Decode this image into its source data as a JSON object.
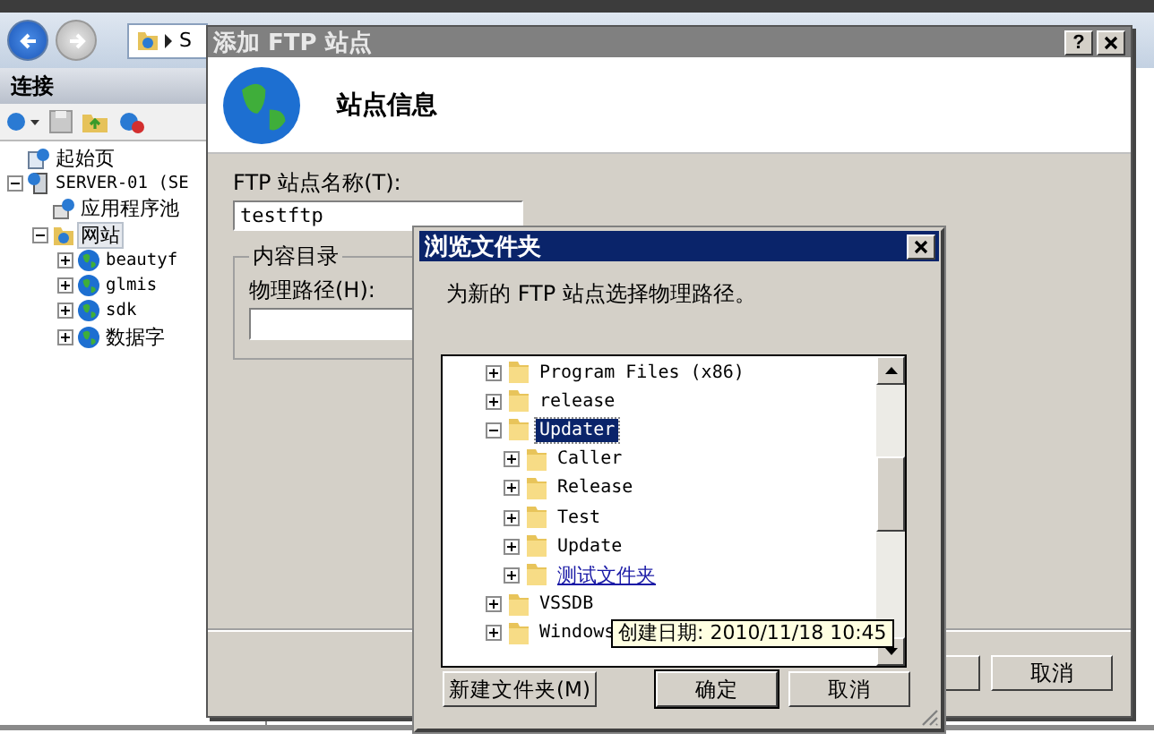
{
  "iis": {
    "address_segment": "S",
    "connections_title": "连接",
    "tree": [
      {
        "label": "起始页",
        "kind": "home",
        "selected": false
      },
      {
        "label": "SERVER-01 (SE",
        "kind": "server",
        "selected": false,
        "expanded": true,
        "children": [
          {
            "label": "应用程序池",
            "kind": "pool",
            "selected": false
          },
          {
            "label": "网站",
            "kind": "sites",
            "selected": true,
            "expanded": true,
            "children": [
              {
                "label": "beautyf",
                "kind": "site",
                "selected": false,
                "expanded": false
              },
              {
                "label": "glmis",
                "kind": "site",
                "selected": false,
                "expanded": false
              },
              {
                "label": "sdk",
                "kind": "site",
                "selected": false,
                "expanded": false
              },
              {
                "label": "数据字",
                "kind": "site",
                "selected": false,
                "expanded": false
              }
            ]
          }
        ]
      }
    ]
  },
  "wizard": {
    "title": "添加 FTP 站点",
    "help": "?",
    "header": "站点信息",
    "site_name_label": "FTP 站点名称(T):",
    "site_name_value": "testftp",
    "group_title": "内容目录",
    "path_label": "物理路径(H):",
    "cancel": "取消"
  },
  "browse": {
    "title": "浏览文件夹",
    "prompt": "为新的 FTP 站点选择物理路径。",
    "tree": [
      {
        "label": "Program Files (x86)",
        "expanded": false,
        "selected": false,
        "hot": false
      },
      {
        "label": "release",
        "expanded": false,
        "selected": false,
        "hot": false
      },
      {
        "label": "Updater",
        "expanded": true,
        "selected": true,
        "hot": false,
        "children": [
          {
            "label": "Caller",
            "expanded": false,
            "selected": false,
            "hot": false
          },
          {
            "label": "Release",
            "expanded": false,
            "selected": false,
            "hot": false
          },
          {
            "label": "Test",
            "expanded": false,
            "selected": false,
            "hot": false
          },
          {
            "label": "Update",
            "expanded": false,
            "selected": false,
            "hot": false
          },
          {
            "label": "测试文件夹",
            "expanded": false,
            "selected": false,
            "hot": true
          }
        ]
      },
      {
        "label": "VSSDB",
        "expanded": false,
        "selected": false,
        "hot": false
      },
      {
        "label": "Windows",
        "expanded": false,
        "selected": false,
        "hot": false
      }
    ],
    "tooltip": "创建日期: 2010/11/18 10:45",
    "buttons": [
      {
        "label": "新建文件夹(M)",
        "default": false
      },
      {
        "label": "确定",
        "default": true
      },
      {
        "label": "取消",
        "default": false
      }
    ]
  }
}
